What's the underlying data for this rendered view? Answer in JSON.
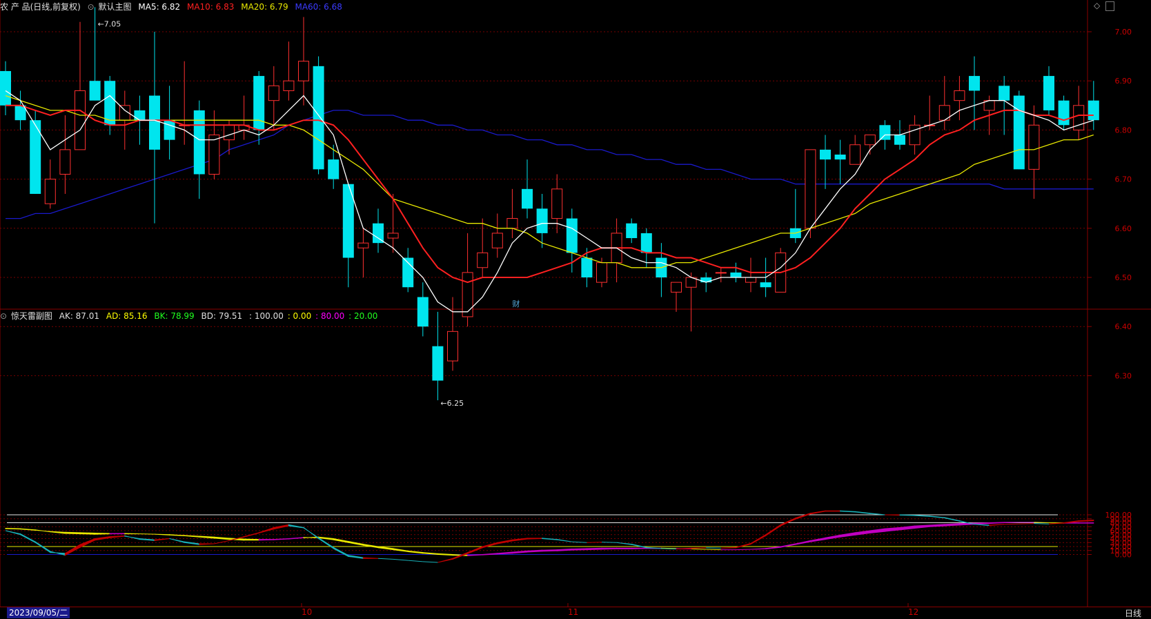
{
  "main_header": {
    "product": "农 产 品(日线,前复权)",
    "template": "默认主图",
    "ma5": "MA5: 6.82",
    "ma10": "MA10: 6.83",
    "ma20": "MA20: 6.79",
    "ma60": "MA60: 6.68"
  },
  "sub_header": {
    "name": "惊天雷副图",
    "ak": "AK: 87.01",
    "ad": "AD: 85.16",
    "bk": "BK: 78.99",
    "bd": "BD: 79.51",
    "l100": ": 100.00",
    "l0": ": 0.00",
    "l80": ": 80.00",
    "l20": ": 20.00"
  },
  "annotations": {
    "high": "7.05",
    "low": "6.25",
    "fin_marker": "财"
  },
  "price_axis": [
    "7.00",
    "6.90",
    "6.80",
    "6.70",
    "6.60",
    "6.50",
    "6.40",
    "6.30"
  ],
  "osc_axis": [
    "100.00",
    "90.00",
    "80.00",
    "70.00",
    "60.00",
    "50.00",
    "40.00",
    "30.00",
    "20.00",
    "10.00",
    "0.00"
  ],
  "date_axis": {
    "start": "2023/09/05/二",
    "m10": "10",
    "m11": "11",
    "m12": "12",
    "period": "日线"
  },
  "colors": {
    "ma5": "#ffffff",
    "ma10": "#ff2020",
    "ma20": "#e8e800",
    "ma60": "#1a1acc",
    "up": "#ff3030",
    "down": "#00e5ee"
  },
  "chart_data": [
    {
      "type": "candlestick",
      "title": "农 产 品(日线,前复权)",
      "ylim": [
        6.22,
        7.05
      ],
      "ohlc": [
        [
          6.92,
          6.94,
          6.83,
          6.85
        ],
        [
          6.85,
          6.88,
          6.8,
          6.82
        ],
        [
          6.82,
          6.84,
          6.67,
          6.67
        ],
        [
          6.65,
          6.74,
          6.64,
          6.7
        ],
        [
          6.71,
          6.83,
          6.67,
          6.76
        ],
        [
          6.76,
          7.02,
          6.76,
          6.88
        ],
        [
          6.9,
          7.05,
          6.86,
          6.86
        ],
        [
          6.9,
          6.91,
          6.79,
          6.81
        ],
        [
          6.82,
          6.88,
          6.76,
          6.85
        ],
        [
          6.84,
          6.87,
          6.77,
          6.82
        ],
        [
          6.87,
          7.0,
          6.61,
          6.76
        ],
        [
          6.82,
          6.89,
          6.74,
          6.78
        ],
        [
          6.81,
          6.94,
          6.77,
          6.81
        ],
        [
          6.84,
          6.86,
          6.66,
          6.71
        ],
        [
          6.71,
          6.84,
          6.7,
          6.79
        ],
        [
          6.78,
          6.82,
          6.75,
          6.81
        ],
        [
          6.8,
          6.87,
          6.78,
          6.81
        ],
        [
          6.91,
          6.92,
          6.77,
          6.8
        ],
        [
          6.86,
          6.93,
          6.8,
          6.89
        ],
        [
          6.88,
          6.98,
          6.86,
          6.9
        ],
        [
          6.9,
          7.03,
          6.85,
          6.94
        ],
        [
          6.93,
          6.95,
          6.71,
          6.72
        ],
        [
          6.74,
          6.77,
          6.68,
          6.7
        ],
        [
          6.69,
          6.69,
          6.48,
          6.54
        ],
        [
          6.56,
          6.6,
          6.5,
          6.57
        ],
        [
          6.61,
          6.64,
          6.55,
          6.57
        ],
        [
          6.58,
          6.67,
          6.55,
          6.59
        ],
        [
          6.54,
          6.56,
          6.47,
          6.48
        ],
        [
          6.46,
          6.49,
          6.38,
          6.4
        ],
        [
          6.36,
          6.43,
          6.25,
          6.29
        ],
        [
          6.33,
          6.46,
          6.31,
          6.39
        ],
        [
          6.42,
          6.59,
          6.4,
          6.51
        ],
        [
          6.52,
          6.62,
          6.5,
          6.55
        ],
        [
          6.56,
          6.63,
          6.54,
          6.59
        ],
        [
          6.6,
          6.68,
          6.58,
          6.62
        ],
        [
          6.68,
          6.74,
          6.62,
          6.64
        ],
        [
          6.64,
          6.67,
          6.56,
          6.59
        ],
        [
          6.62,
          6.71,
          6.59,
          6.68
        ],
        [
          6.62,
          6.64,
          6.51,
          6.55
        ],
        [
          6.54,
          6.56,
          6.48,
          6.5
        ],
        [
          6.49,
          6.54,
          6.48,
          6.53
        ],
        [
          6.53,
          6.62,
          6.49,
          6.59
        ],
        [
          6.61,
          6.62,
          6.57,
          6.58
        ],
        [
          6.59,
          6.6,
          6.52,
          6.55
        ],
        [
          6.54,
          6.57,
          6.46,
          6.5
        ],
        [
          6.47,
          6.49,
          6.43,
          6.49
        ],
        [
          6.48,
          6.51,
          6.39,
          6.5
        ],
        [
          6.5,
          6.51,
          6.47,
          6.49
        ],
        [
          6.51,
          6.52,
          6.49,
          6.51
        ],
        [
          6.51,
          6.53,
          6.49,
          6.5
        ],
        [
          6.49,
          6.54,
          6.47,
          6.5
        ],
        [
          6.49,
          6.54,
          6.46,
          6.48
        ],
        [
          6.47,
          6.56,
          6.47,
          6.55
        ],
        [
          6.6,
          6.68,
          6.57,
          6.58
        ],
        [
          6.6,
          6.69,
          6.58,
          6.76
        ],
        [
          6.76,
          6.79,
          6.68,
          6.74
        ],
        [
          6.75,
          6.78,
          6.69,
          6.74
        ],
        [
          6.73,
          6.79,
          6.75,
          6.77
        ],
        [
          6.77,
          6.79,
          6.75,
          6.79
        ],
        [
          6.81,
          6.82,
          6.76,
          6.78
        ],
        [
          6.79,
          6.82,
          6.76,
          6.77
        ],
        [
          6.77,
          6.83,
          6.75,
          6.81
        ],
        [
          6.81,
          6.87,
          6.8,
          6.81
        ],
        [
          6.82,
          6.91,
          6.8,
          6.85
        ],
        [
          6.86,
          6.91,
          6.82,
          6.88
        ],
        [
          6.91,
          6.95,
          6.8,
          6.88
        ],
        [
          6.84,
          6.87,
          6.79,
          6.86
        ],
        [
          6.89,
          6.91,
          6.79,
          6.86
        ],
        [
          6.87,
          6.88,
          6.72,
          6.72
        ],
        [
          6.72,
          6.85,
          6.66,
          6.81
        ],
        [
          6.91,
          6.93,
          6.83,
          6.84
        ],
        [
          6.86,
          6.87,
          6.8,
          6.81
        ],
        [
          6.8,
          6.89,
          6.78,
          6.85
        ],
        [
          6.86,
          6.9,
          6.8,
          6.82
        ]
      ],
      "series": [
        {
          "name": "MA5",
          "values": [
            6.88,
            6.86,
            6.81,
            6.76,
            6.78,
            6.8,
            6.85,
            6.87,
            6.84,
            6.82,
            6.82,
            6.81,
            6.8,
            6.78,
            6.78,
            6.79,
            6.8,
            6.79,
            6.81,
            6.84,
            6.87,
            6.83,
            6.79,
            6.69,
            6.6,
            6.58,
            6.56,
            6.53,
            6.5,
            6.45,
            6.43,
            6.43,
            6.46,
            6.51,
            6.57,
            6.6,
            6.61,
            6.61,
            6.6,
            6.58,
            6.56,
            6.56,
            6.54,
            6.53,
            6.53,
            6.52,
            6.5,
            6.49,
            6.5,
            6.5,
            6.5,
            6.5,
            6.52,
            6.55,
            6.6,
            6.64,
            6.68,
            6.71,
            6.76,
            6.79,
            6.79,
            6.8,
            6.81,
            6.82,
            6.84,
            6.85,
            6.86,
            6.86,
            6.84,
            6.83,
            6.82,
            6.8,
            6.81,
            6.82
          ]
        },
        {
          "name": "MA10",
          "values": [
            6.85,
            6.85,
            6.84,
            6.83,
            6.84,
            6.84,
            6.82,
            6.81,
            6.81,
            6.82,
            6.82,
            6.82,
            6.81,
            6.81,
            6.81,
            6.81,
            6.81,
            6.8,
            6.8,
            6.81,
            6.82,
            6.82,
            6.81,
            6.78,
            6.74,
            6.7,
            6.66,
            6.61,
            6.56,
            6.52,
            6.5,
            6.49,
            6.5,
            6.5,
            6.5,
            6.5,
            6.51,
            6.52,
            6.53,
            6.55,
            6.56,
            6.56,
            6.56,
            6.55,
            6.55,
            6.54,
            6.54,
            6.53,
            6.52,
            6.52,
            6.51,
            6.51,
            6.51,
            6.52,
            6.54,
            6.57,
            6.6,
            6.64,
            6.67,
            6.7,
            6.72,
            6.74,
            6.77,
            6.79,
            6.8,
            6.82,
            6.83,
            6.84,
            6.84,
            6.83,
            6.83,
            6.82,
            6.83,
            6.83
          ]
        },
        {
          "name": "MA20",
          "values": [
            6.87,
            6.86,
            6.85,
            6.84,
            6.84,
            6.83,
            6.83,
            6.82,
            6.82,
            6.82,
            6.82,
            6.82,
            6.82,
            6.82,
            6.82,
            6.82,
            6.82,
            6.82,
            6.81,
            6.81,
            6.8,
            6.78,
            6.76,
            6.74,
            6.72,
            6.69,
            6.66,
            6.65,
            6.64,
            6.63,
            6.62,
            6.61,
            6.61,
            6.6,
            6.6,
            6.59,
            6.57,
            6.56,
            6.55,
            6.54,
            6.53,
            6.53,
            6.52,
            6.52,
            6.52,
            6.53,
            6.53,
            6.54,
            6.55,
            6.56,
            6.57,
            6.58,
            6.59,
            6.59,
            6.6,
            6.61,
            6.62,
            6.63,
            6.65,
            6.66,
            6.67,
            6.68,
            6.69,
            6.7,
            6.71,
            6.73,
            6.74,
            6.75,
            6.76,
            6.76,
            6.77,
            6.78,
            6.78,
            6.79
          ]
        },
        {
          "name": "MA60",
          "values": [
            6.62,
            6.62,
            6.63,
            6.63,
            6.64,
            6.65,
            6.66,
            6.67,
            6.68,
            6.69,
            6.7,
            6.71,
            6.72,
            6.73,
            6.74,
            6.76,
            6.77,
            6.78,
            6.79,
            6.81,
            6.82,
            6.83,
            6.84,
            6.84,
            6.83,
            6.83,
            6.83,
            6.82,
            6.82,
            6.81,
            6.81,
            6.8,
            6.8,
            6.79,
            6.79,
            6.78,
            6.78,
            6.77,
            6.77,
            6.76,
            6.76,
            6.75,
            6.75,
            6.74,
            6.74,
            6.73,
            6.73,
            6.72,
            6.72,
            6.71,
            6.7,
            6.7,
            6.7,
            6.69,
            6.69,
            6.69,
            6.69,
            6.69,
            6.69,
            6.69,
            6.69,
            6.69,
            6.69,
            6.69,
            6.69,
            6.69,
            6.69,
            6.68,
            6.68,
            6.68,
            6.68,
            6.68,
            6.68,
            6.68
          ]
        }
      ]
    },
    {
      "type": "area",
      "title": "惊天雷副图",
      "ylim": [
        -25,
        115
      ],
      "reference_lines": [
        100,
        80,
        20,
        0
      ],
      "series": [
        {
          "name": "AK",
          "values": [
            60,
            50,
            30,
            5,
            3,
            25,
            40,
            45,
            47,
            38,
            35,
            40,
            30,
            25,
            27,
            35,
            45,
            55,
            68,
            75,
            68,
            40,
            15,
            -5,
            -10,
            -10,
            -12,
            -15,
            -18,
            -20,
            -10,
            5,
            20,
            30,
            37,
            41,
            41,
            38,
            32,
            30,
            31,
            30,
            25,
            17,
            15,
            14,
            16,
            17,
            16,
            18,
            28,
            50,
            75,
            92,
            104,
            110,
            110,
            108,
            104,
            100,
            100,
            99,
            97,
            93,
            85,
            76,
            73,
            76,
            77,
            78,
            77,
            80,
            85,
            87
          ]
        },
        {
          "name": "AD",
          "values": [
            60,
            52,
            32,
            8,
            -2,
            18,
            36,
            42,
            46,
            40,
            37,
            40,
            32,
            27,
            27,
            35,
            44,
            54,
            64,
            72,
            67,
            42,
            18,
            -2,
            -8,
            -10,
            -12,
            -15,
            -18,
            -20,
            -12,
            2,
            17,
            27,
            34,
            39,
            40,
            37,
            32,
            30,
            31,
            30,
            26,
            18,
            15,
            14,
            15,
            17,
            16,
            17,
            26,
            47,
            72,
            89,
            102,
            109,
            109,
            107,
            103,
            100,
            99,
            98,
            96,
            92,
            84,
            76,
            74,
            76,
            77,
            78,
            77,
            79,
            83,
            85
          ]
        },
        {
          "name": "BK",
          "values": [
            65,
            64,
            61,
            58,
            56,
            55,
            54,
            53,
            53,
            52,
            51,
            50,
            48,
            46,
            44,
            41,
            39,
            38,
            38,
            40,
            43,
            42,
            37,
            30,
            23,
            17,
            12,
            7,
            3,
            0,
            -2,
            -3,
            -1,
            1,
            3,
            6,
            8,
            9,
            11,
            12,
            13,
            14,
            14,
            15,
            15,
            14,
            14,
            13,
            12,
            12,
            13,
            14,
            18,
            25,
            32,
            38,
            44,
            49,
            54,
            58,
            62,
            66,
            70,
            72,
            74,
            76,
            78,
            80,
            81,
            81,
            80,
            79,
            79,
            79
          ]
        },
        {
          "name": "BD",
          "values": [
            66,
            65,
            62,
            57,
            53,
            52,
            51,
            52,
            52,
            52,
            51,
            49,
            47,
            44,
            41,
            38,
            36,
            36,
            37,
            39,
            42,
            44,
            40,
            33,
            26,
            20,
            15,
            9,
            5,
            2,
            0,
            -2,
            0,
            3,
            6,
            9,
            11,
            12,
            14,
            15,
            16,
            16,
            16,
            16,
            16,
            15,
            14,
            13,
            12,
            12,
            13,
            15,
            20,
            27,
            35,
            42,
            49,
            55,
            60,
            65,
            68,
            72,
            74,
            76,
            78,
            79,
            80,
            81,
            81,
            81,
            80,
            80,
            80,
            80
          ]
        }
      ]
    }
  ]
}
